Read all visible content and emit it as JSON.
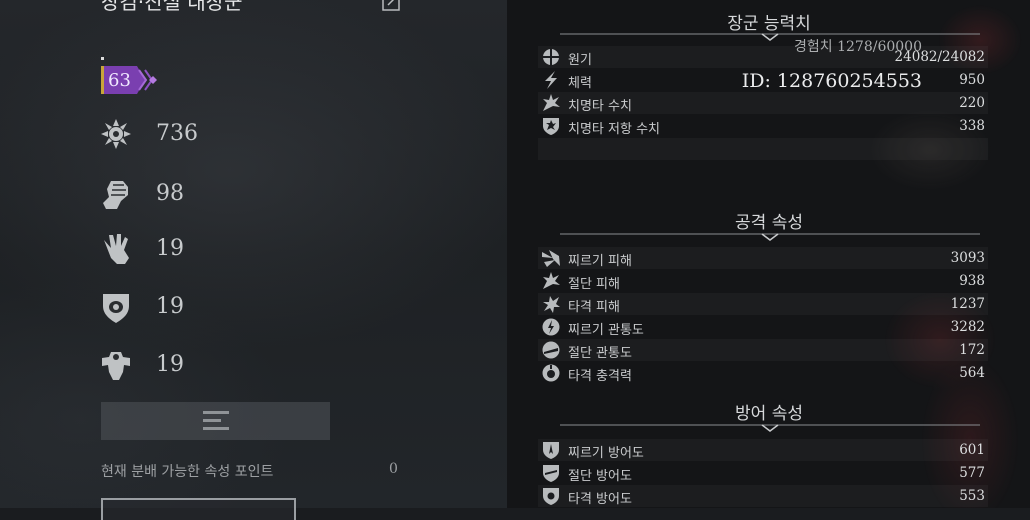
{
  "character": {
    "name": "장검·진실 대장군",
    "exp_label": "경험치",
    "exp_value": "1278/60000",
    "rank": "63",
    "id_text": "ID: 128760254553"
  },
  "attributes": [
    {
      "icon": "gear-burst-icon",
      "value": "736"
    },
    {
      "icon": "fist-icon",
      "value": "98"
    },
    {
      "icon": "hand-icon",
      "value": "19"
    },
    {
      "icon": "shield-eye-icon",
      "value": "19"
    },
    {
      "icon": "muscle-icon",
      "value": "19"
    }
  ],
  "points": {
    "label": "현재 분배 가능한 속성 포인트",
    "value": "0"
  },
  "sections": {
    "general": {
      "title": "장군 능력치",
      "stats": [
        {
          "icon": "cross-icon",
          "label": "원기",
          "value": "24082/24082"
        },
        {
          "icon": "lightning-icon",
          "label": "체력",
          "value": "950"
        },
        {
          "icon": "burst-icon",
          "label": "치명타 수치",
          "value": "220"
        },
        {
          "icon": "shield-burst-icon",
          "label": "치명타 저항 수치",
          "value": "338"
        }
      ]
    },
    "attack": {
      "title": "공격 속성",
      "stats": [
        {
          "icon": "pierce-icon",
          "label": "찌르기 피해",
          "value": "3093"
        },
        {
          "icon": "slash-icon",
          "label": "절단 피해",
          "value": "938"
        },
        {
          "icon": "blunt-icon",
          "label": "타격 피해",
          "value": "1237"
        },
        {
          "icon": "pierce-pen-icon",
          "label": "찌르기 관통도",
          "value": "3282"
        },
        {
          "icon": "slash-pen-icon",
          "label": "절단 관통도",
          "value": "172"
        },
        {
          "icon": "impact-icon",
          "label": "타격 충격력",
          "value": "564"
        }
      ]
    },
    "defense": {
      "title": "방어 속성",
      "stats": [
        {
          "icon": "pierce-defense-icon",
          "label": "찌르기 방어도",
          "value": "601"
        },
        {
          "icon": "slash-defense-icon",
          "label": "절단 방어도",
          "value": "577"
        },
        {
          "icon": "blunt-defense-icon",
          "label": "타격 방어도",
          "value": "553"
        }
      ]
    }
  },
  "colors": {
    "rank_badge": "#7a3fb0",
    "rank_badge_edge": "#c9a53a",
    "text_primary": "#dcdedf"
  }
}
